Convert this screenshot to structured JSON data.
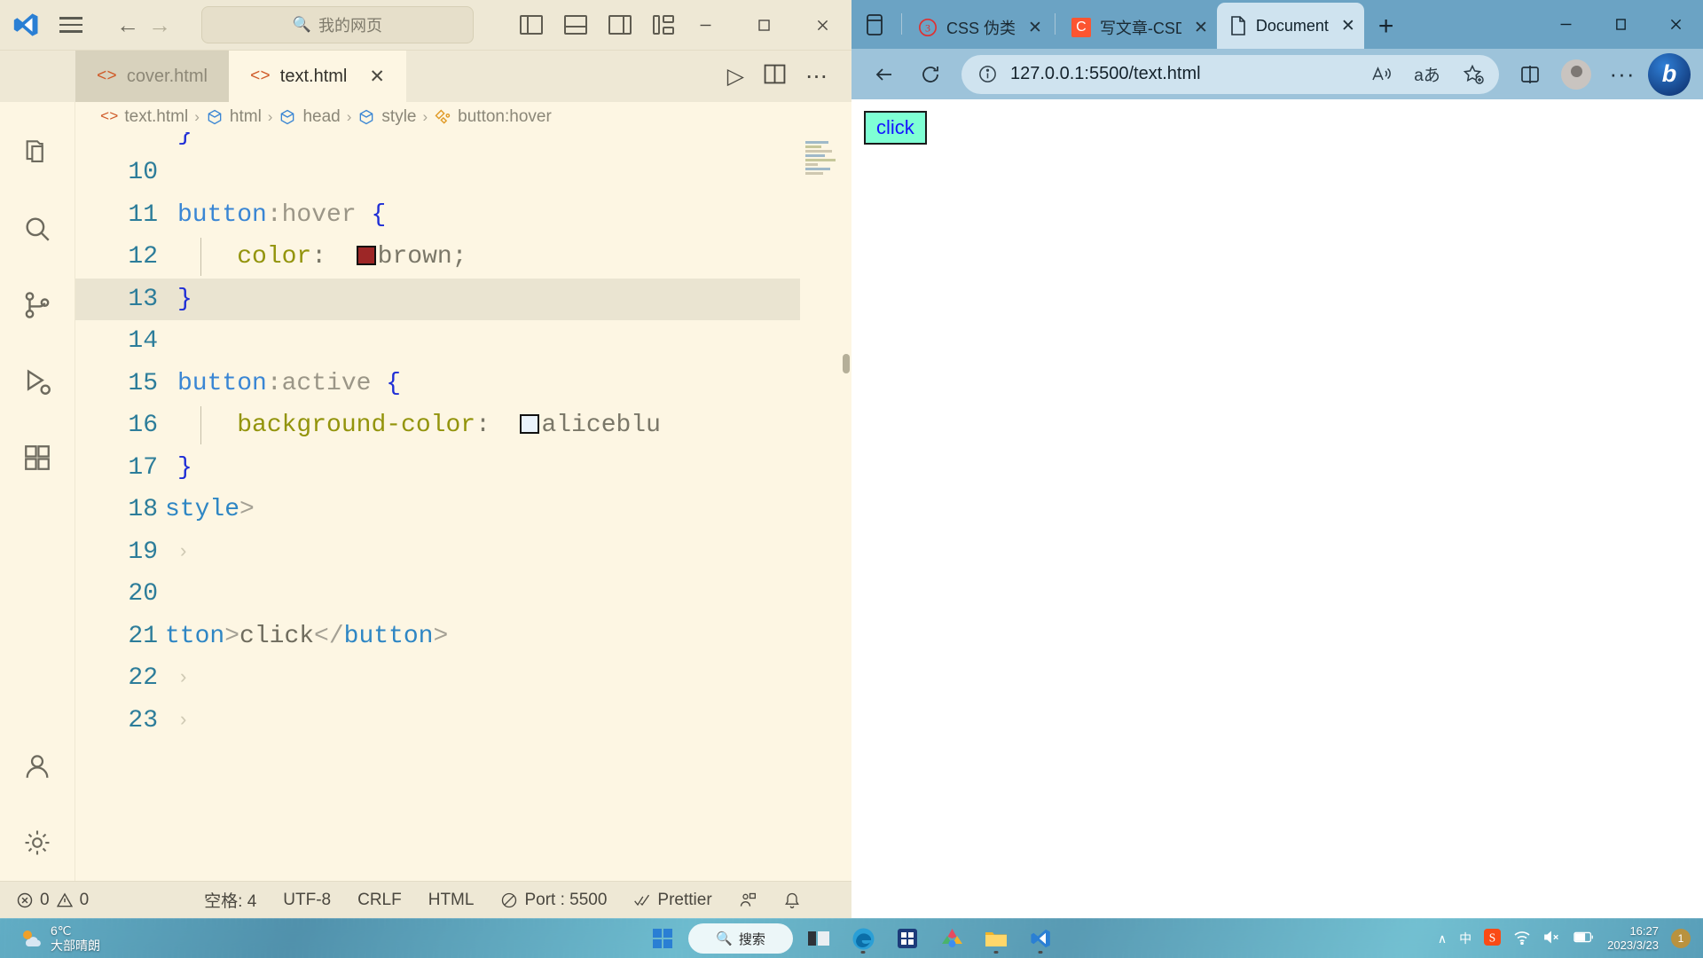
{
  "vscode": {
    "titlebar": {
      "menu_icon": "hamburger-icon",
      "back_icon": "back-arrow-icon",
      "forward_icon": "forward-arrow-icon",
      "search_placeholder": "我的网页",
      "search_icon": "search-icon",
      "layout_icons": [
        "toggle-primary-sidebar-icon",
        "toggle-panel-icon",
        "toggle-secondary-sidebar-icon",
        "customize-layout-icon"
      ],
      "minimize_label": "–",
      "maximize_label": "□",
      "close_label": "✕"
    },
    "tabs": [
      {
        "label": "cover.html",
        "icon": "html-file-icon",
        "active": false,
        "closable": false
      },
      {
        "label": "text.html",
        "icon": "html-file-icon",
        "active": true,
        "closable": true,
        "close_label": "✕"
      }
    ],
    "editor_actions": {
      "run_label": "▷",
      "split_label": "split-editor-icon",
      "more_label": "⋯"
    },
    "activity_bar": [
      {
        "name": "explorer",
        "icon": "files-icon"
      },
      {
        "name": "search",
        "icon": "search-icon"
      },
      {
        "name": "source-control",
        "icon": "source-control-icon"
      },
      {
        "name": "run-and-debug",
        "icon": "run-debug-icon"
      },
      {
        "name": "extensions",
        "icon": "extensions-icon"
      },
      {
        "name": "accounts",
        "icon": "account-icon"
      },
      {
        "name": "settings",
        "icon": "gear-icon"
      }
    ],
    "breadcrumb": [
      {
        "label": "text.html",
        "icon": "html-file-icon"
      },
      {
        "label": "html",
        "icon": "symbol-field-icon"
      },
      {
        "label": "head",
        "icon": "symbol-field-icon"
      },
      {
        "label": "style",
        "icon": "symbol-field-icon"
      },
      {
        "label": "button:hover",
        "icon": "symbol-ruler-icon"
      }
    ],
    "breadcrumb_separator": "›",
    "code_lines": [
      {
        "num": "10",
        "text": "",
        "highlighted": false
      },
      {
        "num": "11",
        "text": "button:hover {",
        "highlighted": false
      },
      {
        "num": "12",
        "text": "    color:  brown;",
        "highlighted": false
      },
      {
        "num": "13",
        "text": "}",
        "highlighted": true
      },
      {
        "num": "14",
        "text": "",
        "highlighted": false
      },
      {
        "num": "15",
        "text": "button:active {",
        "highlighted": false
      },
      {
        "num": "16",
        "text": "    background-color:  aliceblu",
        "highlighted": false
      },
      {
        "num": "17",
        "text": "}",
        "highlighted": false
      },
      {
        "num": "18",
        "text": "style>",
        "highlighted": false
      },
      {
        "num": "19",
        "text": "›",
        "highlighted": false
      },
      {
        "num": "20",
        "text": "",
        "highlighted": false
      },
      {
        "num": "21",
        "text": "tton>click</button>",
        "highlighted": false
      },
      {
        "num": "22",
        "text": "›",
        "highlighted": false
      },
      {
        "num": "23",
        "text": "›",
        "highlighted": false
      }
    ],
    "partial_line_above": "}",
    "color_swatches": {
      "brown": "#9d2626",
      "aliceblue": "#eaf3fb"
    },
    "status_bar": {
      "errors": "0",
      "warnings": "0",
      "indent": "空格: 4",
      "encoding": "UTF-8",
      "eol": "CRLF",
      "language": "HTML",
      "port": "Port : 5500",
      "formatter": "Prettier",
      "error_icon": "error-circle-icon",
      "warning_icon": "warning-triangle-icon",
      "port_icon": "broadcast-icon",
      "prettier_icon": "checkmark-icon",
      "remote_icon": "feedback-icon",
      "bell_icon": "bell-icon"
    }
  },
  "edge": {
    "tab_search_icon": "tab-actions-icon",
    "tabs": [
      {
        "label": "CSS 伪类",
        "favicon": "css-site-icon",
        "active": false,
        "close_label": "✕"
      },
      {
        "label": "写文章-CSDN",
        "favicon": "csdn-icon",
        "active": false,
        "close_label": "✕"
      },
      {
        "label": "Document",
        "favicon": "page-icon",
        "active": true,
        "close_label": "✕"
      }
    ],
    "new_tab_label": "+",
    "window": {
      "minimize": "–",
      "maximize": "□",
      "close": "✕"
    },
    "nav": {
      "back_icon": "back-arrow-icon",
      "refresh_icon": "refresh-icon",
      "info_icon": "info-circle-icon",
      "url": "127.0.0.1:5500/text.html",
      "read_aloud_icon": "read-aloud-icon",
      "translate_icon": "translate-icon",
      "favorite_icon": "add-favorite-star-icon",
      "split_screen_icon": "split-screen-icon",
      "profile_icon": "profile-avatar-icon",
      "settings_icon": "more-options-icon",
      "copilot_icon": "bing-copilot-icon"
    },
    "page": {
      "button_label": "click",
      "button_bg": "#7fffd4",
      "button_text_color": "#1414ff"
    }
  },
  "taskbar": {
    "weather": {
      "temp": "6℃",
      "desc": "大部晴朗",
      "icon": "weather-sun-cloud-icon"
    },
    "start_icon": "windows-start-icon",
    "search_placeholder": "搜索",
    "search_icon": "search-icon",
    "pinned": [
      {
        "name": "task-view",
        "icon": "task-view-icon"
      },
      {
        "name": "edge",
        "icon": "edge-icon",
        "running": true
      },
      {
        "name": "microsoft-store",
        "icon": "store-icon"
      },
      {
        "name": "photos",
        "icon": "photos-icon"
      },
      {
        "name": "file-explorer",
        "icon": "folder-icon",
        "running": true
      },
      {
        "name": "vscode",
        "icon": "vscode-icon",
        "running": true
      }
    ],
    "tray": {
      "chevron": "∧",
      "ime": "中",
      "sogou_icon": "sogou-input-icon",
      "wifi_icon": "wifi-icon",
      "volume_icon": "volume-muted-icon",
      "battery_icon": "battery-charging-icon",
      "time": "16:27",
      "date": "2023/3/23",
      "badge": "1"
    }
  }
}
